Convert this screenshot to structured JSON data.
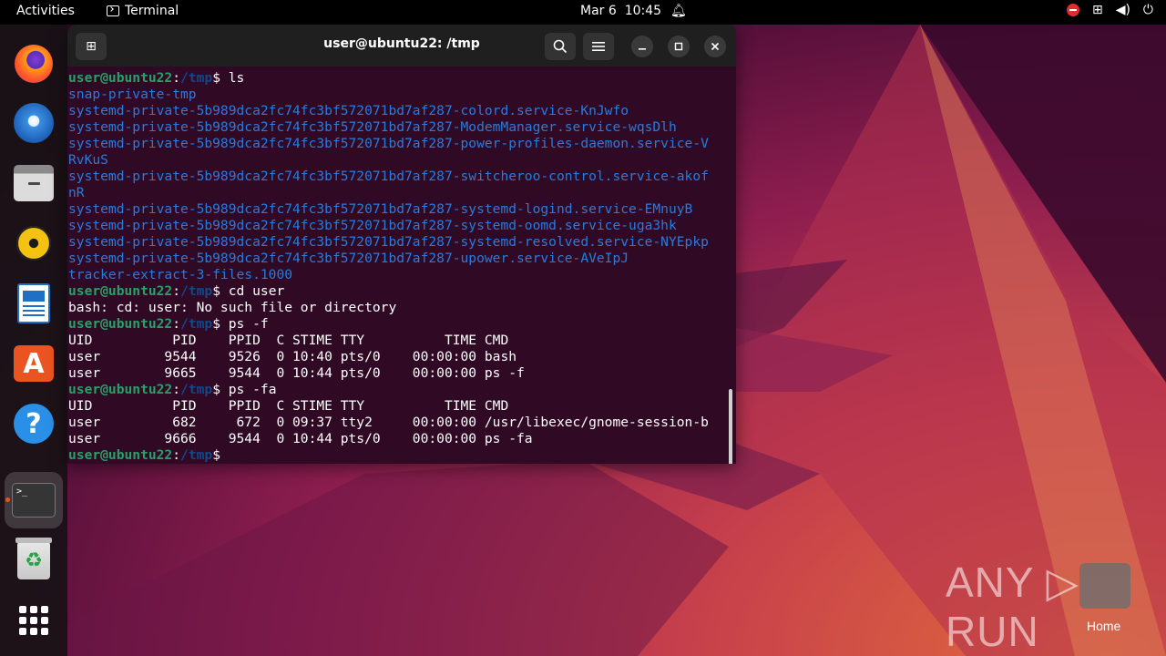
{
  "topbar": {
    "activities": "Activities",
    "app_name": "Terminal",
    "date": "Mar 6",
    "time": "10:45"
  },
  "dock": {
    "items": [
      {
        "name": "firefox",
        "icon": "firefox-icon"
      },
      {
        "name": "thunderbird",
        "icon": "thunderbird-icon"
      },
      {
        "name": "files",
        "icon": "files-icon"
      },
      {
        "name": "rhythmbox",
        "icon": "rhythmbox-icon"
      },
      {
        "name": "libreoffice-writer",
        "icon": "writer-icon"
      },
      {
        "name": "app-center",
        "icon": "app-center-icon",
        "glyph": "A"
      },
      {
        "name": "help",
        "icon": "help-icon",
        "glyph": "?"
      },
      {
        "name": "terminal",
        "icon": "terminal-icon",
        "glyph": ">_"
      },
      {
        "name": "trash",
        "icon": "trash-icon",
        "glyph": "♻"
      },
      {
        "name": "show-apps",
        "icon": "app-grid-icon"
      }
    ]
  },
  "terminal": {
    "title": "user@ubuntu22: /tmp",
    "prompt_user": "user@ubuntu22",
    "prompt_sep": ":",
    "prompt_path": "/tmp",
    "prompt_end": "$",
    "lines": [
      {
        "kind": "prompt",
        "cmd": " ls"
      },
      {
        "kind": "dir",
        "text": "snap-private-tmp"
      },
      {
        "kind": "dir",
        "text": "systemd-private-5b989dca2fc74fc3bf572071bd7af287-colord.service-KnJwfo"
      },
      {
        "kind": "dir",
        "text": "systemd-private-5b989dca2fc74fc3bf572071bd7af287-ModemManager.service-wqsDlh"
      },
      {
        "kind": "dir",
        "text": "systemd-private-5b989dca2fc74fc3bf572071bd7af287-power-profiles-daemon.service-V"
      },
      {
        "kind": "dir",
        "text": "RvKuS"
      },
      {
        "kind": "dir",
        "text": "systemd-private-5b989dca2fc74fc3bf572071bd7af287-switcheroo-control.service-akof"
      },
      {
        "kind": "dir",
        "text": "nR"
      },
      {
        "kind": "dir",
        "text": "systemd-private-5b989dca2fc74fc3bf572071bd7af287-systemd-logind.service-EMnuyB"
      },
      {
        "kind": "dir",
        "text": "systemd-private-5b989dca2fc74fc3bf572071bd7af287-systemd-oomd.service-uga3hk"
      },
      {
        "kind": "dir",
        "text": "systemd-private-5b989dca2fc74fc3bf572071bd7af287-systemd-resolved.service-NYEpkp"
      },
      {
        "kind": "dir",
        "text": "systemd-private-5b989dca2fc74fc3bf572071bd7af287-upower.service-AVeIpJ"
      },
      {
        "kind": "dir",
        "text": "tracker-extract-3-files.1000"
      },
      {
        "kind": "prompt",
        "cmd": " cd user"
      },
      {
        "kind": "out",
        "text": "bash: cd: user: No such file or directory"
      },
      {
        "kind": "prompt",
        "cmd": " ps -f"
      },
      {
        "kind": "out",
        "text": "UID          PID    PPID  C STIME TTY          TIME CMD"
      },
      {
        "kind": "out",
        "text": "user        9544    9526  0 10:40 pts/0    00:00:00 bash"
      },
      {
        "kind": "out",
        "text": "user        9665    9544  0 10:44 pts/0    00:00:00 ps -f"
      },
      {
        "kind": "prompt",
        "cmd": " ps -fa"
      },
      {
        "kind": "out",
        "text": "UID          PID    PPID  C STIME TTY          TIME CMD"
      },
      {
        "kind": "out",
        "text": "user         682     672  0 09:37 tty2     00:00:00 /usr/libexec/gnome-session-b"
      },
      {
        "kind": "out",
        "text": "user        9666    9544  0 10:44 pts/0    00:00:00 ps -fa"
      },
      {
        "kind": "prompt",
        "cmd": ""
      }
    ]
  },
  "desktop": {
    "watermark": "ANY ▷ RUN",
    "home_label": "Home"
  }
}
